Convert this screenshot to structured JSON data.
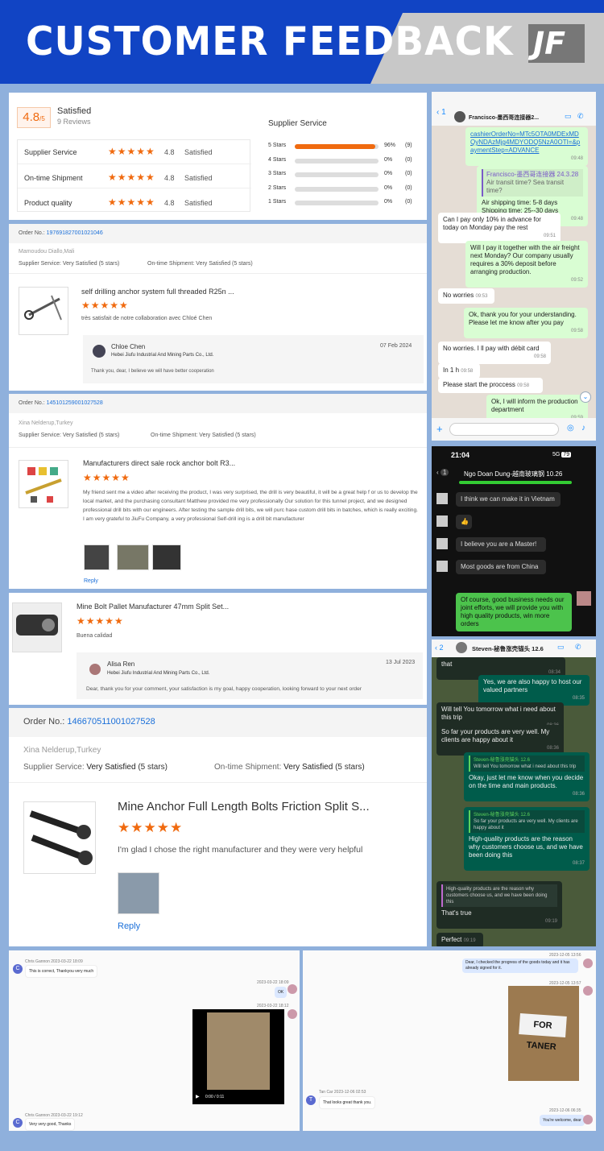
{
  "header": {
    "title": "CUSTOMER FEEDBACK",
    "logo": "JF"
  },
  "rating": {
    "score": "4.8",
    "of": "/5",
    "label": "Satisfied",
    "reviews": "9 Reviews",
    "supplier_service_title": "Supplier Service",
    "rows": [
      {
        "name": "Supplier Service",
        "score": "4.8",
        "label": "Satisfied"
      },
      {
        "name": "On-time Shipment",
        "score": "4.8",
        "label": "Satisfied"
      },
      {
        "name": "Product quality",
        "score": "4.8",
        "label": "Satisfied"
      }
    ],
    "bars": [
      {
        "label": "5 Stars",
        "pct": "96%",
        "count": "(9)",
        "fill": 0.96
      },
      {
        "label": "4 Stars",
        "pct": "0%",
        "count": "(0)",
        "fill": 0
      },
      {
        "label": "3 Stars",
        "pct": "0%",
        "count": "(0)",
        "fill": 0
      },
      {
        "label": "2 Stars",
        "pct": "0%",
        "count": "(0)",
        "fill": 0
      },
      {
        "label": "1 Stars",
        "pct": "0%",
        "count": "(0)",
        "fill": 0
      }
    ]
  },
  "r1": {
    "order_label": "Order No.:",
    "order_no": "197691827001021046",
    "buyer": "Mamoudou Diallo,Mali",
    "supplier": "Supplier Service:  Very Satisfied  (5 stars)",
    "shipment": "On-time Shipment:  Very Satisfied  (5 stars)",
    "product": "self drilling anchor system full threaded R25n ...",
    "stars": "★★★★★",
    "comment": "très satisfait de notre collaboration avec Chloé Chen",
    "reply_name": "Chloe Chen",
    "reply_date": "07 Feb 2024",
    "reply_company": "Hebei Jiufu Industrial And Mining Parts Co., Ltd.",
    "reply_text": "Thank you, dear, I believe we will have better cooperation"
  },
  "r2": {
    "order_label": "Order No.:",
    "order_no": "145101259001027528",
    "buyer": "Xina Nelderup,Turkey",
    "supplier": "Supplier Service:  Very Satisfied  (5 stars)",
    "shipment": "On-time Shipment:  Very Satisfied  (5 stars)",
    "product": "Manufacturers direct sale rock anchor bolt R3...",
    "stars": "★★★★★",
    "comment": "My friend sent me a video after receiving the product, I was very surprised, the drill is very beautiful, it will be a great help f or us to develop the local market, and the purchasing consultant Matthew provided me very professionally Our solution for this tunnel project, and we designed professional drill bits with our engineers. After testing the sample drill bits, we will purc hase custom drill bits in batches, which is really exciting. I am very grateful to JiuFu Company, a very professional Self-drill ing is a drill bit manufacturer",
    "reply": "Reply"
  },
  "r3": {
    "product": "Mine Bolt Pallet Manufacturer 47mm Split Set...",
    "stars": "★★★★★",
    "comment": "Buena calidad",
    "reply_name": "Alisa Ren",
    "reply_date": "13 Jul 2023",
    "reply_company": "Hebei Jiufu Industrial And Mining Parts Co., Ltd.",
    "reply_text": "Dear, thank you for your comment, your satisfaction is my goal, happy cooperation, looking forward to your next order"
  },
  "r4": {
    "order_label": "Order No.:",
    "order_no": "146670511001027528",
    "buyer": "Xina Nelderup,Turkey",
    "supplier_l": "Supplier Service:",
    "supplier_v": "Very Satisfied",
    "supplier_s": "(5 stars)",
    "shipment_l": "On-time Shipment:",
    "shipment_v": "Very Satisfied",
    "shipment_s": "(5 stars)",
    "product": "Mine Anchor Full Length Bolts Friction Split S...",
    "stars": "★★★★★",
    "comment": "I'm glad I chose the right manufacturer and they were very helpful",
    "reply": "Reply"
  },
  "chat1": {
    "title": "Francisco-墨西哥连接器2...",
    "link": "cashierOrderNo=MTc5OTA0MDExMDQyNDAzMjg4MDYODQ5NzA0OTI=&paymentStep=ADVANCE",
    "t1": "09:48",
    "quote_name": "Francisco-墨西哥连接器 24.3.28",
    "quote_text": "Air transit time? Sea transit time?",
    "m2": "Air shipping time: 5-8 days Shipping time: 25--30 days",
    "t2": "09:48",
    "m3": "Can I pay only 10% in advance for today on Monday pay the rest",
    "t3": "09:51",
    "m4": "Will I pay it together with the air freight next Monday? Our company usually requires a 30% deposit before arranging production.",
    "t4": "09:52",
    "m5": "No worries",
    "t5": "09:53",
    "m6": "Ok, thank you for your understanding. Please let me know after you pay",
    "t6": "09:58",
    "m7": "No worries. I ll pay with débit card",
    "t7": "09:58",
    "m8": "In 1 h",
    "t8": "09:58",
    "m9": "Please start the proccess",
    "t9": "09:58",
    "m10": "Ok, I will inform the production department",
    "t10": "09:59",
    "back": "1"
  },
  "chat2": {
    "time": "21:04",
    "signal": "5G",
    "battery": "79",
    "back": "1",
    "title": "Ngo Doan Dung-越南玻璃钢 10.26",
    "m1": "I think we can make it in Vietnam",
    "m2": "👍",
    "m3": "I believe you are a Master!",
    "m4": "Most goods are from China",
    "m5": "Of course, good business needs our joint efforts, we will provide you with high quality products, win more orders"
  },
  "chat3": {
    "back": "2",
    "title": "Steven-秘鲁涨壳锚头 12.6",
    "m0": "that",
    "t0": "08:34",
    "m1": "Yes, we are also happy to host our valued partners",
    "t1": "08:35",
    "m2": "Will tell You tomorrow what i need about this trip",
    "t2": "08:36",
    "m3": "So far your products are very well. My clients are happy about it",
    "t3": "08:36",
    "q1n": "Steven-秘鲁涨壳锚头 12.6",
    "q1": "Will tell You tomorrow what i need about this trip",
    "m4": "Okay, just let me know when you decide on the time and main products.",
    "t4": "08:36",
    "q2n": "Steven-秘鲁涨壳锚头 12.6",
    "q2": "So far your products are very well. My clients are happy about it",
    "m5": "High-quality products are the reason why customers choose us, and we have been doing this",
    "t5": "08:37",
    "q3": "High-quality products are the reason why customers choose us, and we have been doing this",
    "m6": "That's true",
    "t6": "09:19",
    "m7": "Perfect",
    "t7": "09:19"
  },
  "chat4": {
    "n1": "Chris Gannon",
    "d1": "2023-03-22 18:09",
    "msg1": "This is correct, Thankyou very much",
    "d2": "2023-03-22 18:09",
    "ok": "OK",
    "d3": "2023-03-22 18:12",
    "video_time": "0:00 / 0:11",
    "n2": "Chris Gannon",
    "d4": "2023-03-22 19:12",
    "msg2": "Very very good, Thanks"
  },
  "chat5": {
    "d1": "2023-12-05 13:56",
    "msg1": "Dear, I checked the progress of the goods today and it has already signed for it.",
    "d2": "2023-12-05 13:57",
    "box": "FOR TANER",
    "n1": "Tan Car",
    "d3": "2023-12-06 02:53",
    "msg2": "That looks great thank you.",
    "d4": "2023-12-06 06:35",
    "msg3": "You're welcome, dear"
  }
}
